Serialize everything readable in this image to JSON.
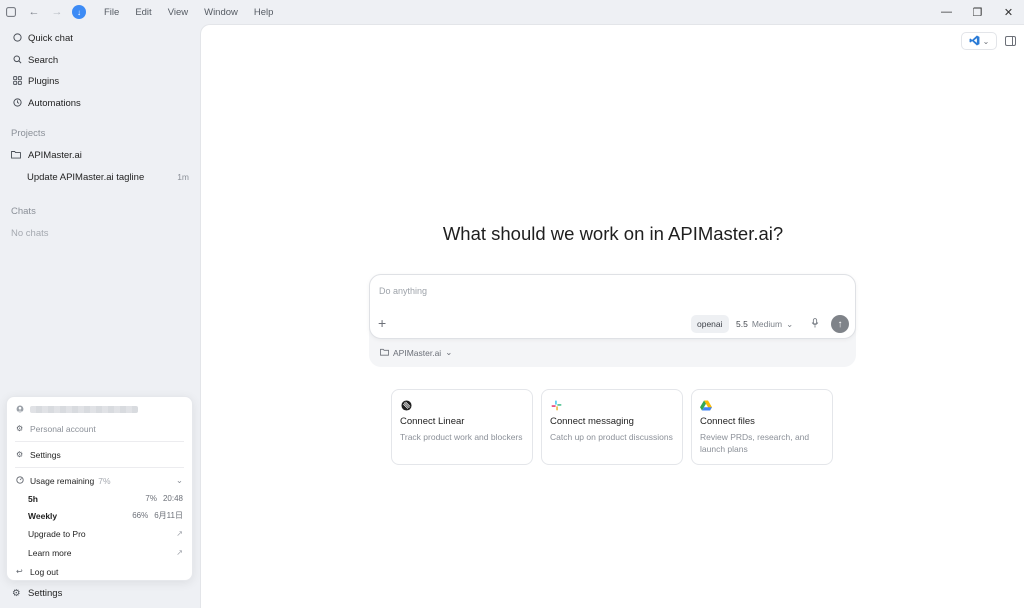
{
  "titlebar": {
    "menu": [
      "File",
      "Edit",
      "View",
      "Window",
      "Help"
    ]
  },
  "sidebar": {
    "nav": [
      {
        "label": "Quick chat",
        "icon": "chat-circle-icon"
      },
      {
        "label": "Search",
        "icon": "search-icon"
      },
      {
        "label": "Plugins",
        "icon": "grid-icon"
      },
      {
        "label": "Automations",
        "icon": "clock-icon"
      }
    ],
    "projects_label": "Projects",
    "project": "APIMaster.ai",
    "thread": {
      "title": "Update APIMaster.ai tagline",
      "time": "1m"
    },
    "chats_label": "Chats",
    "no_chats": "No chats",
    "bottom_settings": "Settings"
  },
  "account_menu": {
    "personal_account": "Personal account",
    "settings": "Settings",
    "usage_label": "Usage remaining",
    "usage_percent": "7%",
    "usage_rows": [
      {
        "label": "5h",
        "percent": "7%",
        "reset": "20:48"
      },
      {
        "label": "Weekly",
        "percent": "66%",
        "reset": "6月11日"
      }
    ],
    "upgrade": "Upgrade to Pro",
    "learn_more": "Learn more",
    "logout": "Log out"
  },
  "main": {
    "headline": "What should we work on in APIMaster.ai?",
    "composer": {
      "placeholder": "Do anything",
      "provider": "openai",
      "model_version": "5.5",
      "model_effort": "Medium",
      "context": "APIMaster.ai"
    },
    "cards": [
      {
        "title": "Connect Linear",
        "desc": "Track product work and blockers",
        "icon": "linear-logo-icon"
      },
      {
        "title": "Connect messaging",
        "desc": "Catch up on product discussions",
        "icon": "slack-logo-icon"
      },
      {
        "title": "Connect files",
        "desc": "Review PRDs, research, and launch plans",
        "icon": "google-drive-logo-icon"
      }
    ]
  },
  "colors": {
    "sidebar_bg": "#eef0f4",
    "main_bg": "#ffffff",
    "send_button": "#7f8389",
    "app_badge": "#3d8bf5",
    "vscode_blue": "#2b7bd6"
  }
}
